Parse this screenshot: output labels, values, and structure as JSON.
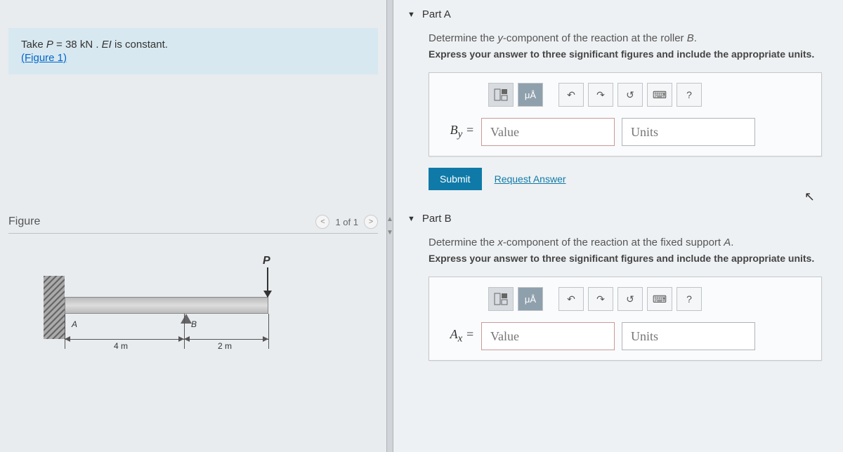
{
  "problem": {
    "line1_pre": "Take ",
    "line1_var": "P",
    "line1_eq": " = 38 kN . ",
    "line1_ei": "EI",
    "line1_post": " is constant.",
    "figure_link": "(Figure 1)"
  },
  "figure": {
    "title": "Figure",
    "nav_text": "1 of 1",
    "load_label": "P",
    "point_a": "A",
    "point_b": "B",
    "dim1": "4 m",
    "dim2": "2 m"
  },
  "partA": {
    "header": "Part A",
    "prompt_pre": "Determine the ",
    "prompt_var": "y",
    "prompt_mid": "-component of the reaction at the roller ",
    "prompt_pt": "B",
    "prompt_post": ".",
    "instruct": "Express your answer to three significant figures and include the appropriate units.",
    "var_label": "B",
    "var_sub": "y",
    "eq": " =",
    "value_ph": "Value",
    "units_ph": "Units",
    "submit": "Submit",
    "request": "Request Answer",
    "tb_mu": "μÅ",
    "tb_help": "?"
  },
  "partB": {
    "header": "Part B",
    "prompt_pre": "Determine the ",
    "prompt_var": "x",
    "prompt_mid": "-component of the reaction at the fixed support ",
    "prompt_pt": "A",
    "prompt_post": ".",
    "instruct": "Express your answer to three significant figures and include the appropriate units.",
    "var_label": "A",
    "var_sub": "x",
    "eq": " =",
    "value_ph": "Value",
    "units_ph": "Units",
    "tb_mu": "μÅ",
    "tb_help": "?"
  }
}
